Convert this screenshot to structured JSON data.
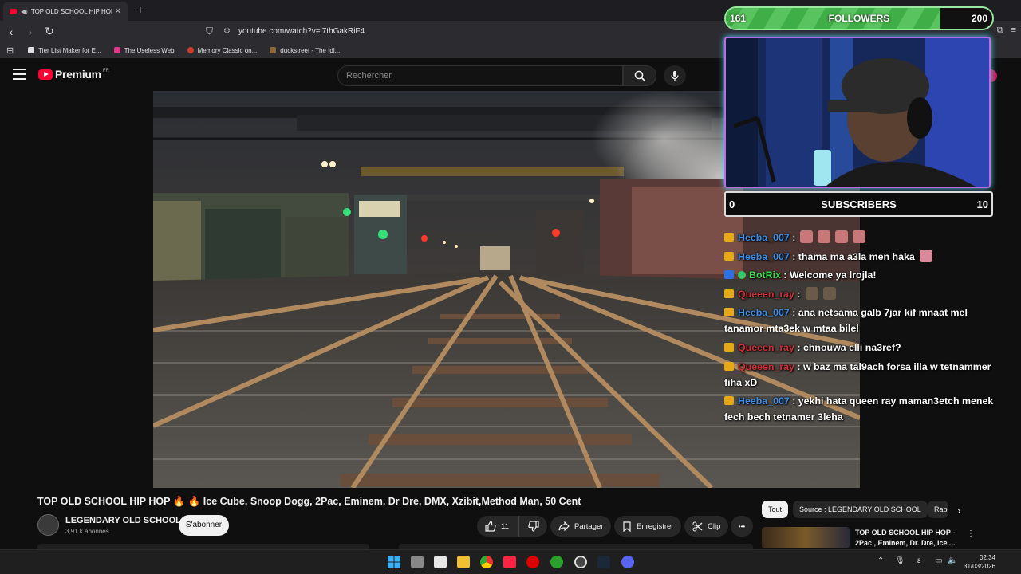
{
  "browser": {
    "tab_title": "TOP OLD SCHOOL HIP HOP 🔥",
    "url": "youtube.com/watch?v=i7thGakRiF4",
    "bookmarks": [
      {
        "label": "Tier List Maker for E...",
        "color": "#e0e0e0"
      },
      {
        "label": "The Useless Web",
        "color": "#e0358a"
      },
      {
        "label": "Memory Classic on...",
        "color": "#d23a2a"
      },
      {
        "label": "duckstreet - The Idl...",
        "color": "#8b6a3a"
      }
    ]
  },
  "youtube": {
    "logo_text": "Premium",
    "country": "FR",
    "search_placeholder": "Rechercher"
  },
  "overlay": {
    "followers": {
      "current": "161",
      "label": "FOLLOWERS",
      "goal": "200",
      "progress": 0.805
    },
    "subscribers": {
      "current": "0",
      "label": "SUBSCRIBERS",
      "goal": "10"
    },
    "chat": [
      {
        "user": "Heeba_007",
        "color": "user-blue",
        "badge": "crown",
        "text": " :",
        "emotes": [
          "#c9787a",
          "#c9787a",
          "#c9787a",
          "#c9787a"
        ]
      },
      {
        "user": "Heeba_007",
        "color": "user-blue",
        "badge": "crown",
        "text": " : thama ma a3la men haka",
        "emotes": [
          "#d88a9a"
        ]
      },
      {
        "user": "BotRix",
        "color": "user-green",
        "badge": "bot",
        "text": " : Welcome ya lrojla!",
        "emotes": []
      },
      {
        "user": "Queeen_ray",
        "color": "user-red",
        "badge": "crown",
        "text": " :",
        "emotes": [
          "#6a5a4a",
          "#6a5a4a"
        ]
      },
      {
        "user": "Heeba_007",
        "color": "user-blue",
        "badge": "crown",
        "text": " : ana netsama galb 7jar kif mnaat mel tanamor mta3ek w mtaa bilel",
        "emotes": []
      },
      {
        "user": "Queeen_ray",
        "color": "user-red",
        "badge": "crown",
        "text": " : chnouwa elli na3ref?",
        "emotes": []
      },
      {
        "user": "Queeen_ray",
        "color": "user-red",
        "badge": "crown",
        "text": " : w baz ma tal9ach forsa illa w tetnammer fiha xD",
        "emotes": []
      },
      {
        "user": "Heeba_007",
        "color": "user-blue",
        "badge": "crown",
        "text": " : yekhi hata queen ray maman3etch menek fech bech tetnamer 3leha",
        "emotes": []
      }
    ]
  },
  "video": {
    "title": "TOP OLD SCHOOL HIP HOP 🔥 🔥 Ice Cube, Snoop Dogg, 2Pac, Eminem, Dr Dre, DMX, Xzibit,Method Man, 50 Cent",
    "channel": "LEGENDARY OLD SCHOOL",
    "subscribers": "3,91 k abonnés",
    "subscribe_label": "S'abonner",
    "likes": "11",
    "share_label": "Partager",
    "save_label": "Enregistrer",
    "clip_label": "Clip",
    "more": "•••"
  },
  "sidebar": {
    "chips": [
      "Tout",
      "Source : LEGENDARY OLD SCHOOL",
      "Rap"
    ],
    "rec_title": "TOP OLD SCHOOL HIP HOP - 2Pac , Eminem, Dr. Dre, Ice ..."
  },
  "taskbar": {
    "time": "02:34",
    "date": "31/03/2026",
    "lang": "ε"
  }
}
